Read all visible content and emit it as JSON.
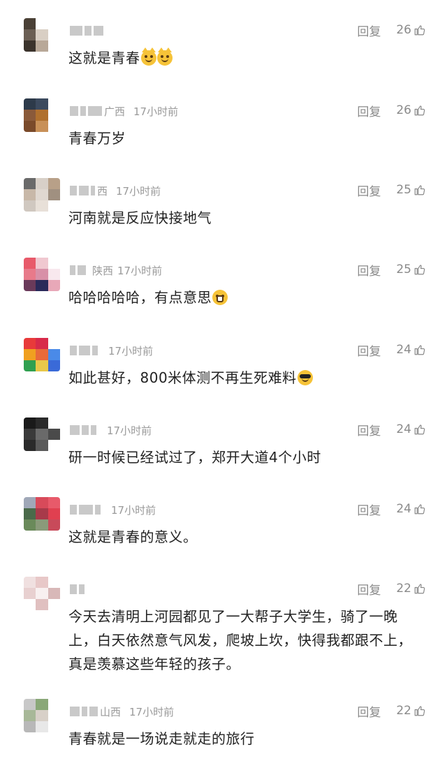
{
  "labels": {
    "reply": "回复"
  },
  "comments": [
    {
      "nickname_shown": "",
      "location": "",
      "time": "",
      "likes": "26",
      "text": "这就是青春",
      "emojis": [
        "cat-smirk-emoji",
        "cat-smirk-emoji"
      ],
      "avatar_colors": [
        "#4a4036",
        "#ffffff",
        "#ffffff",
        "#6b5f54",
        "#d9cfc4",
        "#ffffff",
        "#3b332c",
        "#b8a898",
        "#ffffff"
      ]
    },
    {
      "nickname_shown": "广西",
      "location": "",
      "time": "17小时前",
      "likes": "26",
      "text": "青春万岁",
      "emojis": [],
      "avatar_colors": [
        "#2d3a4a",
        "#3c4a5e",
        "#ffffff",
        "#8a5a3a",
        "#b0702e",
        "#ffffff",
        "#7a4a2a",
        "#c89058",
        "#ffffff"
      ]
    },
    {
      "nickname_shown": "西",
      "location": "",
      "time": "17小时前",
      "likes": "25",
      "text": "河南就是反应快接地气",
      "emojis": [],
      "avatar_colors": [
        "#6a6a6a",
        "#d8d0c8",
        "#b8a088",
        "#c8b8a8",
        "#e0d8d0",
        "#a09080",
        "#d0c8c0",
        "#e8e0d8",
        "#ffffff"
      ]
    },
    {
      "nickname_shown": "",
      "location": "陕西",
      "time": "17小时前",
      "likes": "25",
      "text": "哈哈哈哈哈，有点意思",
      "emojis": [
        "grin-emoji"
      ],
      "avatar_colors": [
        "#e85a6a",
        "#f0c8d0",
        "#ffffff",
        "#e87a8a",
        "#d890a8",
        "#f8e8ee",
        "#6a3a5a",
        "#2a2a5a",
        "#e8a8b8"
      ]
    },
    {
      "nickname_shown": "",
      "location": "",
      "time": "17小时前",
      "likes": "24",
      "text": "如此甚好，800米体测不再生死难料",
      "emojis": [
        "sunglasses-emoji"
      ],
      "avatar_colors": [
        "#e83a3a",
        "#d82a4a",
        "#ffffff",
        "#f0a020",
        "#e86a3a",
        "#4a8ae8",
        "#30a050",
        "#e8c84a",
        "#3a6ad8"
      ]
    },
    {
      "nickname_shown": "",
      "location": "",
      "time": "17小时前",
      "likes": "24",
      "text": "研一时候已经试过了，郑开大道4个小时",
      "emojis": [],
      "avatar_colors": [
        "#1a1a1a",
        "#2a2a2a",
        "#ffffff",
        "#3a3a3a",
        "#6a6a6a",
        "#4a4a4a",
        "#2a2a2a",
        "#5a5a5a",
        "#ffffff"
      ]
    },
    {
      "nickname_shown": "",
      "location": "",
      "time": "17小时前",
      "likes": "24",
      "text": "这就是青春的意义。",
      "emojis": [],
      "avatar_colors": [
        "#a0a8b8",
        "#d84a5a",
        "#e85a6a",
        "#4a6a4a",
        "#a83a4a",
        "#e04050",
        "#6a8a5a",
        "#8a9a7a",
        "#c84a5a"
      ]
    },
    {
      "nickname_shown": "",
      "location": "",
      "time": "",
      "likes": "22",
      "text": "今天去清明上河园都见了一大帮子大学生，骑了一晚上，白天依然意气风发，爬坡上坎，快得我都跟不上，真是羡慕这些年轻的孩子。",
      "emojis": [],
      "avatar_colors": [
        "#f0e0e0",
        "#e8c8c8",
        "#ffffff",
        "#e8d0d0",
        "#f8f0f0",
        "#d8b8b8",
        "#ffffff",
        "#e0c0c0",
        "#ffffff"
      ]
    },
    {
      "nickname_shown": "山西",
      "location": "",
      "time": "17小时前",
      "likes": "22",
      "text": "青春就是一场说走就走的旅行",
      "emojis": [],
      "avatar_colors": [
        "#c8c8c8",
        "#8aa878",
        "#ffffff",
        "#a8b898",
        "#d8d0c8",
        "#ffffff",
        "#b8b8b8",
        "#e8e8e8",
        "#ffffff"
      ]
    }
  ]
}
